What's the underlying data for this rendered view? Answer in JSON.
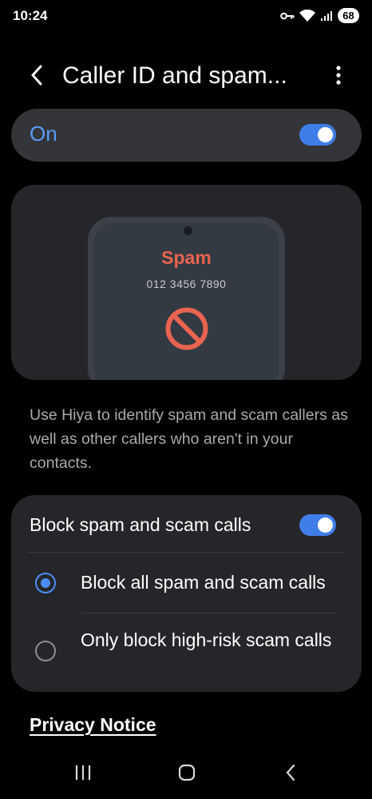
{
  "status_bar": {
    "time": "10:24",
    "battery": "68",
    "icons": [
      "vpn-key-icon",
      "wifi-icon",
      "signal-icon",
      "battery-icon"
    ]
  },
  "app_bar": {
    "title": "Caller ID and spam...",
    "back_icon": "chevron-left-icon",
    "more_icon": "more-vertical-icon"
  },
  "master_toggle": {
    "label": "On",
    "checked": true,
    "accent": "#3f7de8",
    "label_color": "#5b9bf7"
  },
  "illustration": {
    "title": "Spam",
    "number": "012 3456 7890",
    "icon": "block-icon",
    "accent": "#e86450"
  },
  "description": "Use Hiya to identify spam and scam callers as well as other callers who aren't in your contacts.",
  "block_section": {
    "label": "Block spam and scam calls",
    "checked": true,
    "options": [
      {
        "label": "Block all spam and scam calls",
        "selected": true
      },
      {
        "label": "Only block high-risk scam calls",
        "selected": false
      }
    ]
  },
  "privacy_link": "Privacy Notice",
  "nav_bar": {
    "icons": [
      "recents-icon",
      "home-icon",
      "back-icon"
    ]
  }
}
